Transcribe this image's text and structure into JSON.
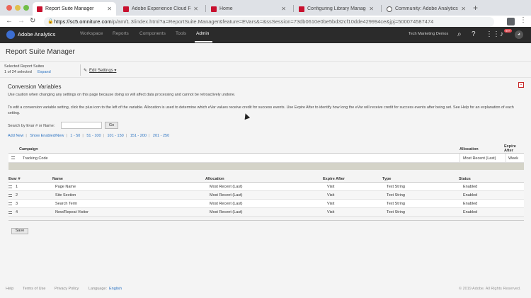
{
  "browser": {
    "tabs": [
      {
        "title": "Report Suite Manager",
        "active": true
      },
      {
        "title": "Adobe Experience Cloud Relea",
        "active": false
      },
      {
        "title": "Home",
        "active": false
      },
      {
        "title": "Configuring Library Managem",
        "active": false
      },
      {
        "title": "Community: Adobe Analytics",
        "active": false
      }
    ],
    "url_host": "https://sc5.omniture.com",
    "url_rest": "/p/am/1.3/index.html?a=ReportSuite.Manager&feature=EVars&=&ssSession=73db0610e0be5bd32cf10dde429994ce&jpj=500074587474"
  },
  "app": {
    "name": "Adobe Analytics",
    "nav": [
      "Workspace",
      "Reports",
      "Components",
      "Tools",
      "Admin"
    ],
    "active_nav": "Admin",
    "company": "Tech Marketing Demos",
    "notification_count": "99+"
  },
  "page": {
    "title": "Report Suite Manager",
    "selected_label": "Selected Report Suites",
    "selected_count": "1 of 24 selected",
    "expand": "Expand",
    "edit_settings": "Edit Settings",
    "section_title": "Conversion Variables",
    "warning": "Use caution when changing any settings on this page because doing so will affect data processing and cannot be retroactively undone.",
    "help": "To edit a conversion variable setting, click the plus icon to the left of the variable. Allocation is used to determine which eVar values receive credit for success events. Use Expire After to identify how long the eVar will receive credit for success events after being set. See Help for an explanation of each setting.",
    "search_label": "Search by Evar # or Name:",
    "search_value": "",
    "go": "Go",
    "links": [
      "Add New",
      "Show Enabled/New",
      "1 - 50",
      "51 - 100",
      "101 - 150",
      "151 - 200",
      "201 - 250"
    ]
  },
  "campaign": {
    "headers": {
      "campaign": "Campaign",
      "allocation": "Allocation",
      "expire": "Expire After"
    },
    "row": {
      "name": "Tracking Code",
      "allocation": "Most Recent (Last)",
      "expire": "Week"
    }
  },
  "evars": {
    "headers": [
      "Evar #",
      "Name",
      "Allocation",
      "Expire After",
      "Type",
      "Status"
    ],
    "rows": [
      {
        "num": "1",
        "name": "Page Name",
        "allocation": "Most Recent (Last)",
        "expire": "Visit",
        "type": "Text String",
        "status": "Enabled"
      },
      {
        "num": "2",
        "name": "Site Section",
        "allocation": "Most Recent (Last)",
        "expire": "Visit",
        "type": "Text String",
        "status": "Enabled"
      },
      {
        "num": "3",
        "name": "Search Term",
        "allocation": "Most Recent (Last)",
        "expire": "Visit",
        "type": "Text String",
        "status": "Enabled"
      },
      {
        "num": "4",
        "name": "New/Repeat Visitor",
        "allocation": "Most Recent (Last)",
        "expire": "Visit",
        "type": "Text String",
        "status": "Enabled"
      }
    ]
  },
  "save": "Save",
  "footer": {
    "links": [
      "Help",
      "Terms of Use",
      "Privacy Policy"
    ],
    "language_label": "Language:",
    "language": "English",
    "copyright": "© 2019 Adobe. All Rights Reserved."
  }
}
